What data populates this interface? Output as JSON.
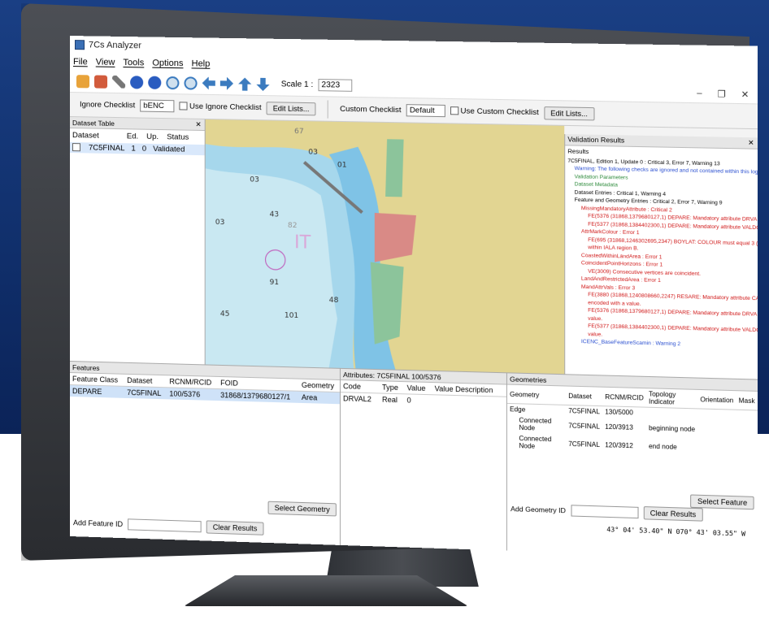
{
  "app": {
    "title": "7Cs Analyzer",
    "menu": [
      "File",
      "View",
      "Tools",
      "Options",
      "Help"
    ],
    "window_controls": [
      "–",
      "❐",
      "✕"
    ]
  },
  "toolbar": {
    "scale_label": "Scale 1 :",
    "scale_value": "2323"
  },
  "checklists": {
    "ignore_label": "Ignore Checklist",
    "ignore_value": "bENC",
    "use_ignore": "Use Ignore Checklist",
    "edit_lists": "Edit Lists...",
    "custom_label": "Custom Checklist",
    "custom_value": "Default",
    "use_custom": "Use Custom Checklist"
  },
  "dataset_table": {
    "title": "Dataset Table",
    "headers": [
      "Dataset",
      "Ed.",
      "Up.",
      "Status"
    ],
    "row": {
      "dataset": "7C5FINAL",
      "ed": "1",
      "up": "0",
      "status": "Validated"
    }
  },
  "map": {
    "labels": [
      "67",
      "03",
      "01",
      "03",
      "43",
      "82",
      "IT",
      "91",
      "101",
      "48",
      "45",
      "03"
    ]
  },
  "validation": {
    "title": "Validation Results",
    "results_label": "Results",
    "rows": [
      {
        "text": "7C5FINAL, Edition 1, Update 0 : Critical 3, Error 7, Warning 13",
        "cls": "",
        "indent": 0
      },
      {
        "text": "Warning: The following checks are ignored and not contained within this log.",
        "cls": "blu",
        "indent": 1
      },
      {
        "text": "Validation Parameters",
        "cls": "grn",
        "indent": 1
      },
      {
        "text": "Dataset Metadata",
        "cls": "grn",
        "indent": 1
      },
      {
        "text": "Dataset Entries : Critical 1, Warning 4",
        "cls": "",
        "indent": 1
      },
      {
        "text": "Feature and Geometry Entries : Critical 2, Error 7, Warning 9",
        "cls": "",
        "indent": 1
      },
      {
        "text": "MissingMandatoryAttribute : Critical 2",
        "cls": "red",
        "indent": 2
      },
      {
        "text": "FE(5376 (31868,1379680127,1) DEPARE: Mandatory attribute DRVAL1 is missing f",
        "cls": "red",
        "indent": 3
      },
      {
        "text": "FE(5377 (31868,1384402300,1) DEPARE: Mandatory attribute VALDCO is missing f",
        "cls": "red",
        "indent": 3
      },
      {
        "text": "AttrMarkColour : Error 1",
        "cls": "red",
        "indent": 2
      },
      {
        "text": "FE(695 (31868,1246302695,2347) BOYLAT: COLOUR must equal 3 (red) for a stand",
        "cls": "red",
        "indent": 3
      },
      {
        "text": "within IALA region B.",
        "cls": "red",
        "indent": 3
      },
      {
        "text": "CoastedWithinLandArea : Error 1",
        "cls": "red",
        "indent": 2
      },
      {
        "text": "CoincidentPointHorizons : Error 1",
        "cls": "red",
        "indent": 2
      },
      {
        "text": "VE(3009) Consecutive vertices are coincident.",
        "cls": "red",
        "indent": 3
      },
      {
        "text": "LandAndRestrictedArea : Error 1",
        "cls": "red",
        "indent": 2
      },
      {
        "text": "MandAttrVals : Error 3",
        "cls": "red",
        "indent": 2
      },
      {
        "text": "FE(3880 (31868,1240808660,2247) RESARE: Mandatory attribute CATREA not fill",
        "cls": "red",
        "indent": 3
      },
      {
        "text": "encoded with a value.",
        "cls": "red",
        "indent": 3
      },
      {
        "text": "FE(5376 (31868,1379680127,1) DEPARE: Mandatory attribute DRVAL1 has not bee",
        "cls": "red",
        "indent": 3
      },
      {
        "text": "value.",
        "cls": "red",
        "indent": 3
      },
      {
        "text": "FE(5377 (31868,1384402300,1) DEPARE: Mandatory attribute VALDCO has not bee",
        "cls": "red",
        "indent": 3
      },
      {
        "text": "value.",
        "cls": "red",
        "indent": 3
      },
      {
        "text": "ICENC_BaseFeatureScamin : Warning 2",
        "cls": "blu",
        "indent": 2
      }
    ]
  },
  "features": {
    "title": "Features",
    "headers": [
      "Feature Class",
      "Dataset",
      "RCNM/RCID",
      "FOID",
      "Geometry"
    ],
    "row": [
      "DEPARE",
      "7C5FINAL",
      "100/5376",
      "31868/1379680127/1",
      "Area"
    ],
    "select_geometry": "Select Geometry",
    "add_label": "Add Feature ID",
    "clear": "Clear Results"
  },
  "attributes": {
    "title": "Attributes: 7C5FINAL 100/5376",
    "headers": [
      "Code",
      "Type",
      "Value",
      "Value Description"
    ],
    "row": [
      "DRVAL2",
      "Real",
      "0",
      ""
    ]
  },
  "geometries": {
    "title": "Geometries",
    "headers": [
      "Geometry",
      "Dataset",
      "RCNM/RCID",
      "Topology Indicator",
      "Orientation",
      "Mask"
    ],
    "rows": [
      {
        "geom": "Geometry",
        "ds": "",
        "rcid": "",
        "topo": "",
        "ori": "",
        "mask": ""
      },
      {
        "geom": "Edge",
        "ds": "7C5FINAL",
        "rcid": "130/5000",
        "topo": "",
        "ori": "",
        "mask": ""
      },
      {
        "geom": "Connected Node",
        "ds": "7C5FINAL",
        "rcid": "120/3913",
        "topo": "beginning node",
        "ori": "",
        "mask": ""
      },
      {
        "geom": "Connected Node",
        "ds": "7C5FINAL",
        "rcid": "120/3912",
        "topo": "end node",
        "ori": "",
        "mask": ""
      }
    ],
    "select_feature": "Select Feature",
    "add_label": "Add Geometry ID",
    "clear": "Clear Results",
    "coords": "43° 04' 53.40\" N  070° 43' 03.55\" W"
  }
}
